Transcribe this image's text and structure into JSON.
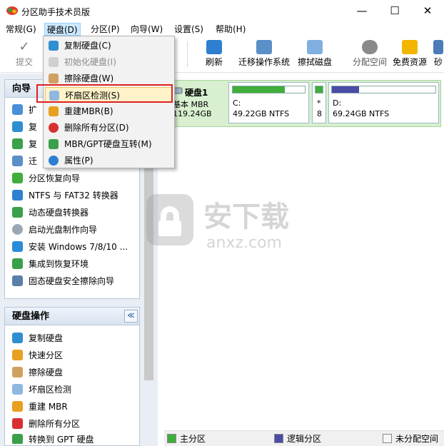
{
  "window": {
    "title": "分区助手技术员版",
    "minimize": "—",
    "maximize": "☐",
    "close": "✕"
  },
  "menu": [
    "常规(G)",
    "硬盘(D)",
    "分区(P)",
    "向导(W)",
    "设置(S)",
    "帮助(H)"
  ],
  "toolbar": {
    "commit": "提交",
    "refresh": "刷新",
    "migrate_os": "迁移操作系统",
    "wipe_disk": "擦拭磁盘",
    "allocate_space": "分配空间",
    "free_resources": "免费资源",
    "more": "砂"
  },
  "disk_menu": {
    "items": [
      {
        "label": "复制硬盘(C)",
        "enabled": true,
        "icon": "copy-disk-icon"
      },
      {
        "label": "初始化硬盘(I)",
        "enabled": false,
        "icon": "init-disk-icon"
      },
      {
        "label": "擦除硬盘(W)",
        "enabled": true,
        "icon": "wipe-disk-icon"
      },
      {
        "label": "坏扇区检测(S)",
        "enabled": true,
        "icon": "bad-sector-icon",
        "highlighted": true
      },
      {
        "label": "重建MBR(B)",
        "enabled": true,
        "icon": "rebuild-mbr-icon"
      },
      {
        "label": "删除所有分区(D)",
        "enabled": true,
        "icon": "delete-partitions-icon"
      },
      {
        "label": "MBR/GPT硬盘互转(M)",
        "enabled": true,
        "icon": "convert-mbr-gpt-icon"
      },
      {
        "label": "属性(P)",
        "enabled": true,
        "icon": "properties-icon"
      }
    ]
  },
  "wizard_panel": {
    "title": "向导",
    "items": [
      "扩",
      "复",
      "复",
      "迁",
      "分区恢复向导",
      "NTFS 与 FAT32 转换器",
      "动态硬盘转换器",
      "启动光盘制作向导",
      "安装 Windows 7/8/10 ...",
      "集成到恢复环境",
      "固态硬盘安全擦除向导"
    ]
  },
  "disk_ops_panel": {
    "title": "硬盘操作",
    "collapse": "≪",
    "items": [
      "复制硬盘",
      "快速分区",
      "擦除硬盘",
      "坏扇区检测",
      "重建 MBR",
      "删除所有分区",
      "转换到 GPT 硬盘"
    ]
  },
  "disk": {
    "name": "硬盘1",
    "type": "基本 MBR",
    "size": "119.24GB",
    "partitions": [
      {
        "letter": "C:",
        "size": "49.22GB NTFS",
        "used_fraction": 0.72,
        "color": "#3fae3a"
      },
      {
        "letter": "*",
        "size": "8",
        "used_fraction": 1.0,
        "color": "#3fae3a"
      },
      {
        "letter": "D:",
        "size": "69.24GB NTFS",
        "used_fraction": 0.26,
        "color": "#4b4ba8"
      }
    ]
  },
  "legend": {
    "primary": "主分区",
    "logical": "逻辑分区",
    "unallocated": "未分配空间",
    "primary_color": "#3fae3a",
    "logical_color": "#4b4ba8"
  },
  "watermark": {
    "text": "安下载",
    "sub": "anxz.com"
  }
}
